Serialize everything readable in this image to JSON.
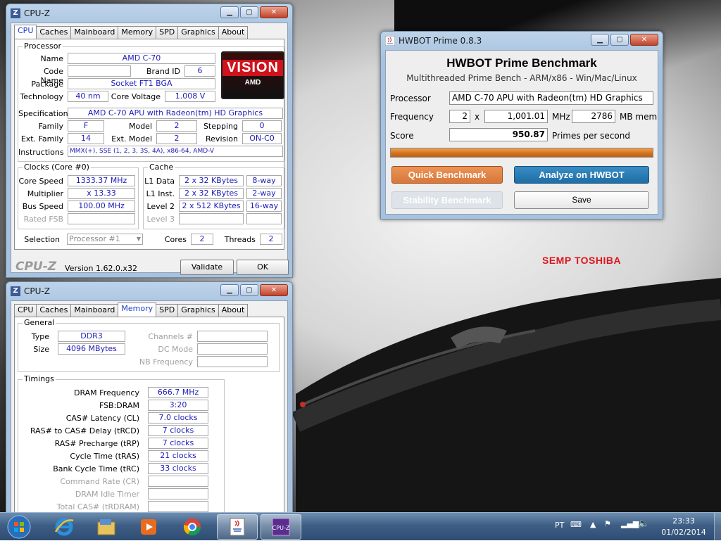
{
  "desktop": {
    "brand": "SEMP TOSHIBA"
  },
  "cpuz_cpu": {
    "title": "CPU-Z",
    "tabs": [
      "CPU",
      "Caches",
      "Mainboard",
      "Memory",
      "SPD",
      "Graphics",
      "About"
    ],
    "active_tab": "CPU",
    "processor": {
      "group": "Processor",
      "name_lbl": "Name",
      "name": "AMD C-70",
      "codename_lbl": "Code Name",
      "codename": "",
      "brandid_lbl": "Brand ID",
      "brandid": "6",
      "package_lbl": "Package",
      "package": "Socket FT1 BGA",
      "tech_lbl": "Technology",
      "tech": "40 nm",
      "voltage_lbl": "Core Voltage",
      "voltage": "1.008 V",
      "spec_lbl": "Specification",
      "spec": "AMD C-70 APU with Radeon(tm) HD Graphics",
      "family_lbl": "Family",
      "family": "F",
      "model_lbl": "Model",
      "model": "2",
      "stepping_lbl": "Stepping",
      "stepping": "0",
      "extfamily_lbl": "Ext. Family",
      "extfamily": "14",
      "extmodel_lbl": "Ext. Model",
      "extmodel": "2",
      "revision_lbl": "Revision",
      "revision": "ON-C0",
      "instr_lbl": "Instructions",
      "instr": "MMX(+), SSE (1, 2, 3, 3S, 4A), x86-64, AMD-V",
      "logo_text": "VISION",
      "logo_sub": "AMD"
    },
    "clocks": {
      "group": "Clocks (Core #0)",
      "corespeed_lbl": "Core Speed",
      "corespeed": "1333.37 MHz",
      "mult_lbl": "Multiplier",
      "mult": "x 13.33",
      "bus_lbl": "Bus Speed",
      "bus": "100.00 MHz",
      "fsb_lbl": "Rated FSB",
      "fsb": ""
    },
    "cache": {
      "group": "Cache",
      "l1d_lbl": "L1 Data",
      "l1d": "2 x 32 KBytes",
      "l1d_way": "8-way",
      "l1i_lbl": "L1 Inst.",
      "l1i": "2 x 32 KBytes",
      "l1i_way": "2-way",
      "l2_lbl": "Level 2",
      "l2": "2 x 512 KBytes",
      "l2_way": "16-way",
      "l3_lbl": "Level 3",
      "l3": "",
      "l3_way": ""
    },
    "selection": {
      "lbl": "Selection",
      "value": "Processor #1",
      "cores_lbl": "Cores",
      "cores": "2",
      "threads_lbl": "Threads",
      "threads": "2"
    },
    "footer": {
      "logo": "CPU-Z",
      "version": "Version 1.62.0.x32",
      "validate": "Validate",
      "ok": "OK"
    }
  },
  "cpuz_mem": {
    "title": "CPU-Z",
    "tabs": [
      "CPU",
      "Caches",
      "Mainboard",
      "Memory",
      "SPD",
      "Graphics",
      "About"
    ],
    "active_tab": "Memory",
    "general": {
      "group": "General",
      "type_lbl": "Type",
      "type": "DDR3",
      "size_lbl": "Size",
      "size": "4096 MBytes",
      "channels_lbl": "Channels #",
      "channels": "",
      "dcmode_lbl": "DC Mode",
      "dcmode": "",
      "nbfreq_lbl": "NB Frequency",
      "nbfreq": ""
    },
    "timings": {
      "group": "Timings",
      "rows": [
        {
          "label": "DRAM Frequency",
          "value": "666.7 MHz",
          "enabled": true
        },
        {
          "label": "FSB:DRAM",
          "value": "3:20",
          "enabled": true
        },
        {
          "label": "CAS# Latency (CL)",
          "value": "7.0 clocks",
          "enabled": true
        },
        {
          "label": "RAS# to CAS# Delay (tRCD)",
          "value": "7 clocks",
          "enabled": true
        },
        {
          "label": "RAS# Precharge (tRP)",
          "value": "7 clocks",
          "enabled": true
        },
        {
          "label": "Cycle Time (tRAS)",
          "value": "21 clocks",
          "enabled": true
        },
        {
          "label": "Bank Cycle Time (tRC)",
          "value": "33 clocks",
          "enabled": true
        },
        {
          "label": "Command Rate (CR)",
          "value": "",
          "enabled": false
        },
        {
          "label": "DRAM Idle Timer",
          "value": "",
          "enabled": false
        },
        {
          "label": "Total CAS# (tRDRAM)",
          "value": "",
          "enabled": false
        }
      ]
    }
  },
  "hwbot": {
    "title": "HWBOT Prime 0.8.3",
    "heading": "HWBOT Prime Benchmark",
    "subheading": "Multithreaded Prime Bench - ARM/x86 - Win/Mac/Linux",
    "processor_lbl": "Processor",
    "processor": "AMD C-70 APU with Radeon(tm) HD Graphics",
    "freq_lbl": "Frequency",
    "freq_mult": "2",
    "freq_x": "x",
    "freq": "1,001.01",
    "freq_unit": "MHz",
    "mem": "2786",
    "mem_unit": "MB mem",
    "score_lbl": "Score",
    "score": "950.87",
    "score_unit": "Primes per second",
    "progress": 1.0,
    "quick": "Quick Benchmark",
    "analyze": "Analyze on HWBOT",
    "stability": "Stability Benchmark",
    "save": "Save",
    "colors": {
      "quick": "#d9773a",
      "analyze": "#1f6ea6",
      "progress": "#e0822c"
    }
  },
  "taskbar": {
    "items": [
      "start-orb",
      "internet-explorer",
      "windows-explorer",
      "media-player",
      "chrome",
      "java",
      "cpu-z"
    ],
    "lang": "PT",
    "time": "23:33",
    "date": "01/02/2014"
  }
}
